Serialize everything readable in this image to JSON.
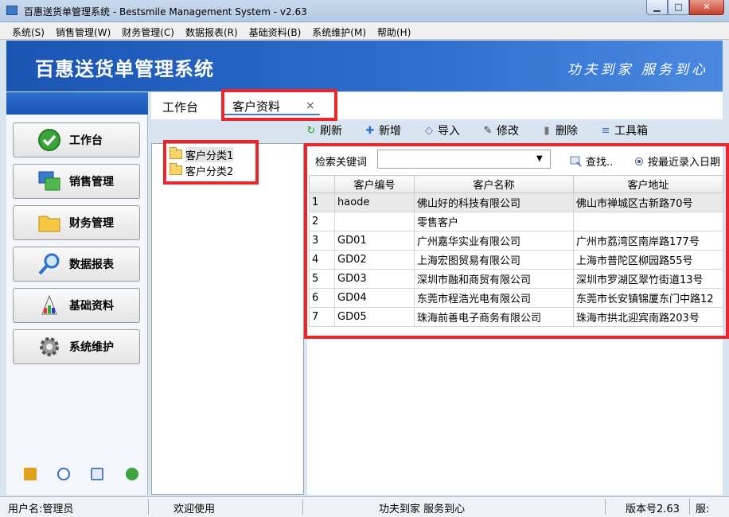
{
  "window": {
    "title": "百惠送货单管理系统 - Bestsmile Management System - v2.63",
    "min": "▁",
    "max": "□",
    "close": "✕"
  },
  "menu": [
    "系统(S)",
    "销售管理(W)",
    "财务管理(C)",
    "数据报表(R)",
    "基础资料(B)",
    "系统维护(M)",
    "帮助(H)"
  ],
  "banner": {
    "title": "百惠送货单管理系统",
    "slogan": "功夫到家 服务到心"
  },
  "sidebar": {
    "items": [
      {
        "label": "工作台",
        "icon": "check-circle-icon"
      },
      {
        "label": "销售管理",
        "icon": "windows-icon"
      },
      {
        "label": "财务管理",
        "icon": "folder-icon"
      },
      {
        "label": "数据报表",
        "icon": "magnifier-icon"
      },
      {
        "label": "基础资料",
        "icon": "palette-icon"
      },
      {
        "label": "系统维护",
        "icon": "gear-icon"
      }
    ],
    "footer_icons": [
      "key-icon",
      "clock-icon",
      "search-icon",
      "back-icon"
    ]
  },
  "tabs": {
    "workbench": "工作台",
    "active": "客户资料",
    "close": "×"
  },
  "toolbar": [
    {
      "label": "刷新",
      "icon": "refresh-icon",
      "glyph": "↻",
      "color": "#2a9a2a"
    },
    {
      "label": "新增",
      "icon": "plus-icon",
      "glyph": "✚",
      "color": "#2f6fcf"
    },
    {
      "label": "导入",
      "icon": "import-icon",
      "glyph": "◇",
      "color": "#5577aa"
    },
    {
      "label": "修改",
      "icon": "edit-icon",
      "glyph": "✎",
      "color": "#333333"
    },
    {
      "label": "删除",
      "icon": "trash-icon",
      "glyph": "▮",
      "color": "#777777"
    },
    {
      "label": "工具箱",
      "icon": "database-icon",
      "glyph": "≡",
      "color": "#5577aa"
    }
  ],
  "tree": [
    "客户分类1",
    "客户分类2"
  ],
  "search": {
    "label": "检索关键词",
    "value": "",
    "find": "查找..",
    "sort": "按最近录入日期"
  },
  "grid": {
    "columns": [
      "",
      "客户编号",
      "客户名称",
      "客户地址"
    ],
    "rows": [
      [
        "1",
        "haode",
        "佛山好的科技有限公司",
        "佛山市禅城区古新路70号"
      ],
      [
        "2",
        "",
        "零售客户",
        ""
      ],
      [
        "3",
        "GD01",
        "广州嘉华实业有限公司",
        "广州市荔湾区南岸路177号"
      ],
      [
        "4",
        "GD02",
        "上海宏图贸易有限公司",
        "上海市普陀区柳园路55号"
      ],
      [
        "5",
        "GD03",
        "深圳市融和商贸有限公司",
        "深圳市罗湖区翠竹街道13号"
      ],
      [
        "6",
        "GD04",
        "东莞市程浩光电有限公司",
        "东莞市长安镇锦厦东门中路12"
      ],
      [
        "7",
        "GD05",
        "珠海前善电子商务有限公司",
        "珠海市拱北迎宾南路203号"
      ]
    ]
  },
  "status": {
    "user": "用户名:管理员",
    "welcome": "欢迎使用",
    "slogan": "功夫到家 服务到心",
    "version": "版本号2.63",
    "service": "服:"
  },
  "colors": {
    "banner": "#1a55b3",
    "highlight": "#e8262c",
    "accent": "#3b7bd6"
  }
}
